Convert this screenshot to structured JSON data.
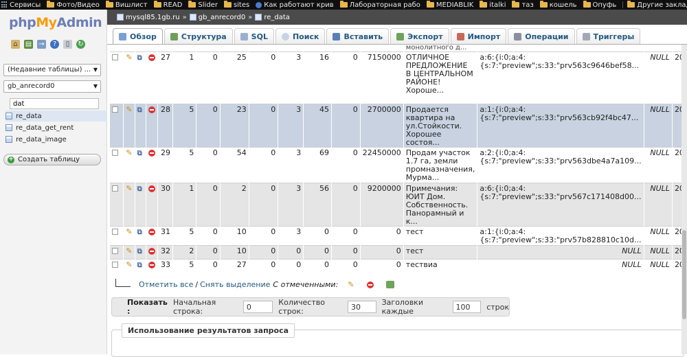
{
  "bookmarks": {
    "items": [
      "Сервисы",
      "Фото/Видео",
      "Вишлист",
      "READ",
      "Slider",
      "sites",
      "Как работают крив",
      "Лабораторная рабо",
      "MEDIABLIK",
      "italki",
      "таз",
      "кошель",
      "Опуфь"
    ],
    "other": "Другие закладки"
  },
  "sidebar": {
    "logo_php": "php",
    "logo_my": "My",
    "logo_admin": "Admin",
    "recent_tables": "(Недавние таблицы) ...",
    "database": "gb_anrecord0",
    "filter_value": "dat",
    "tables": [
      "re_data",
      "re_data_get_rent",
      "re_data_image"
    ],
    "create_table": "Создать таблицу"
  },
  "breadcrumb": {
    "server": "mysql85.1gb.ru",
    "database": "gb_anrecord0",
    "table": "re_data",
    "separator": "»"
  },
  "tabs": [
    "Обзор",
    "Структура",
    "SQL",
    "Поиск",
    "Вставить",
    "Экспорт",
    "Импорт",
    "Операции",
    "Триггеры"
  ],
  "grid": {
    "top_fragment": "монолитного д...",
    "rows": [
      {
        "id": "27",
        "c1": "1",
        "c2": "0",
        "c3": "25",
        "c4": "0",
        "c5": "3",
        "c6": "16",
        "c7": "0",
        "price": "7150000",
        "desc": "ОТЛИЧНОЕ ПРЕДЛОЖЕНИЕ В ЦЕНТРАЛЬНОМ РАЙОНЕ! Хороше...",
        "ser": "a:6:{i:0;a:4:{s:7:\"preview\";s:33:\"prv563c9646bef58...",
        "nul": "NULL",
        "last": "20"
      },
      {
        "id": "28",
        "c1": "5",
        "c2": "0",
        "c3": "23",
        "c4": "0",
        "c5": "3",
        "c6": "45",
        "c7": "0",
        "price": "2700000",
        "desc": "Продается квартира на ул.Стойкости. Хорошее состоя...",
        "ser": "a:1:{i:0;a:4:{s:7:\"preview\";s:33:\"prv563cb92f4bc47...",
        "nul": "NULL",
        "last": "20"
      },
      {
        "id": "29",
        "c1": "5",
        "c2": "0",
        "c3": "54",
        "c4": "0",
        "c5": "3",
        "c6": "69",
        "c7": "0",
        "price": "22450000",
        "desc": "Продам участок 1.7 га, земли промназначения, Мурма...",
        "ser": "a:2:{i:0;a:4:{s:7:\"preview\";s:33:\"prv563dbe4a7a109...",
        "nul": "NULL",
        "last": "20"
      },
      {
        "id": "30",
        "c1": "1",
        "c2": "0",
        "c3": "2",
        "c4": "0",
        "c5": "3",
        "c6": "56",
        "c7": "0",
        "price": "9200000",
        "desc": "Примечания: ЮИТ Дом. Собственность. Панорамный и к...",
        "ser": "a:6:{i:0;a:4:{s:7:\"preview\";s:33:\"prv567c171408d00...",
        "nul": "NULL",
        "last": "20"
      },
      {
        "id": "31",
        "c1": "5",
        "c2": "0",
        "c3": "10",
        "c4": "0",
        "c5": "3",
        "c6": "0",
        "c7": "0",
        "price": "0",
        "desc": "тест",
        "ser": "a:1:{i:0;a:4:{s:7:\"preview\";s:33:\"prv57b828810c10d...",
        "nul": "NULL",
        "last": "20"
      },
      {
        "id": "32",
        "c1": "2",
        "c2": "0",
        "c3": "10",
        "c4": "0",
        "c5": "0",
        "c6": "0",
        "c7": "0",
        "price": "0",
        "desc": "тест",
        "ser": "NULL",
        "nul": "NULL",
        "last": "20"
      },
      {
        "id": "33",
        "c1": "5",
        "c2": "0",
        "c3": "27",
        "c4": "0",
        "c5": "0",
        "c6": "0",
        "c7": "0",
        "price": "0",
        "desc": "тествиа",
        "ser": "NULL",
        "nul": "NULL",
        "last": "20"
      }
    ]
  },
  "selection": {
    "check_all": "Отметить все",
    "sep": "/",
    "uncheck": "Снять выделение",
    "with_selected": "С отмеченными:"
  },
  "show": {
    "label": "Показать :",
    "start_label": "Начальная строка:",
    "start_value": "0",
    "count_label": "Количество строк:",
    "count_value": "30",
    "headers_label": "Заголовки каждые",
    "headers_value": "100",
    "headers_unit": "строк"
  },
  "results": {
    "legend": "Использование результатов запроса"
  }
}
